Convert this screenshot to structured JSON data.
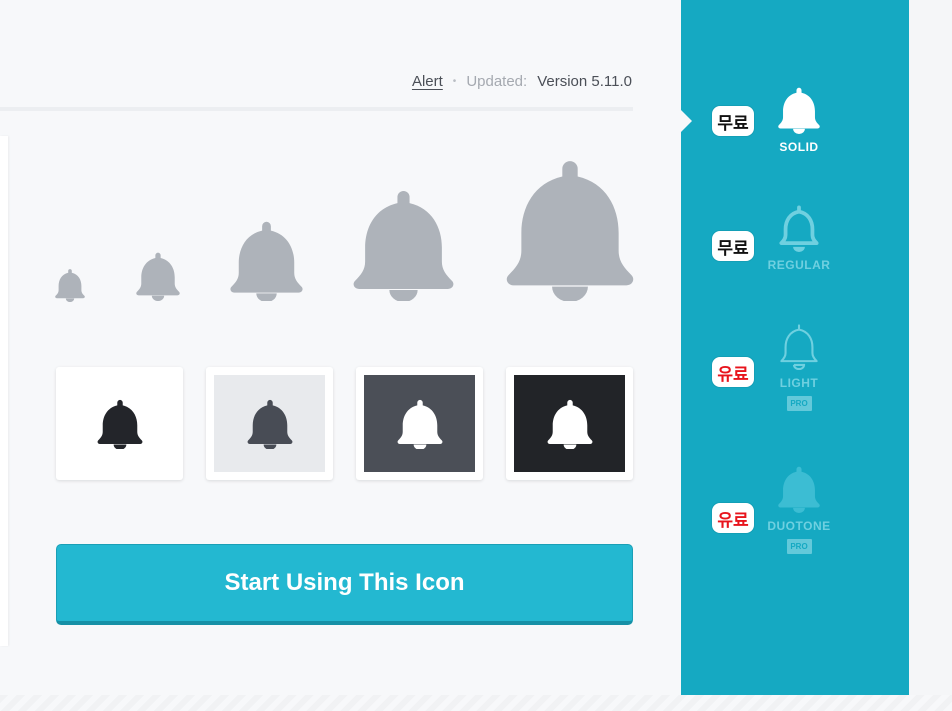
{
  "meta": {
    "icon_name": "Alert",
    "separator": "•",
    "updated_label": "Updated:",
    "version": "Version 5.11.0"
  },
  "size_previews": [
    {
      "name": "bell-size-xs"
    },
    {
      "name": "bell-size-sm"
    },
    {
      "name": "bell-size-md"
    },
    {
      "name": "bell-size-lg"
    },
    {
      "name": "bell-size-xl"
    }
  ],
  "background_previews": [
    {
      "name": "white",
      "bg": "#ffffff",
      "icon": "#23252a"
    },
    {
      "name": "light-gray",
      "bg": "#e8eaed",
      "icon": "#484c55"
    },
    {
      "name": "dark-gray",
      "bg": "#4b4f57",
      "icon": "#ffffff"
    },
    {
      "name": "black",
      "bg": "#222428",
      "icon": "#ffffff"
    }
  ],
  "cta_label": "Start Using This Icon",
  "styles": [
    {
      "label": "SOLID",
      "tag": "무료",
      "tag_color": "#111111",
      "pro": ""
    },
    {
      "label": "REGULAR",
      "tag": "무료",
      "tag_color": "#111111",
      "pro": ""
    },
    {
      "label": "LIGHT",
      "tag": "유료",
      "tag_color": "#e8141c",
      "pro": "PRO"
    },
    {
      "label": "DUOTONE",
      "tag": "유료",
      "tag_color": "#e8141c",
      "pro": "PRO"
    }
  ],
  "colors": {
    "accent": "#23b8d1",
    "sidebar": "#15a9c2",
    "icon_gray": "#aeb3ba"
  },
  "icons": {
    "bell": "bell-icon"
  }
}
